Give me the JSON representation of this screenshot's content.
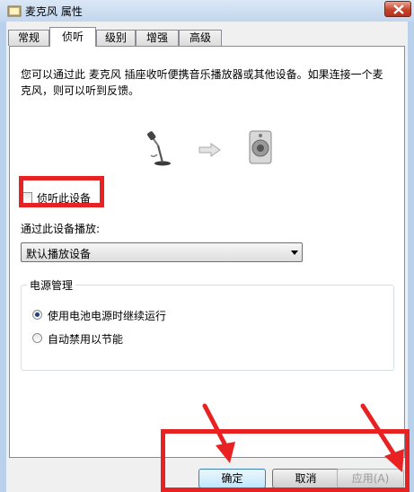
{
  "window": {
    "title": "麦克风 属性",
    "icon": "microphone-icon"
  },
  "tabs": [
    {
      "label": "常规",
      "active": false
    },
    {
      "label": "侦听",
      "active": true
    },
    {
      "label": "级别",
      "active": false
    },
    {
      "label": "增强",
      "active": false
    },
    {
      "label": "高级",
      "active": false
    }
  ],
  "listen": {
    "description": "您可以通过此 麦克风 插座收听便携音乐播放器或其他设备。如果连接一个麦克风，则可以听到反馈。",
    "icons": [
      "microphone-icon",
      "arrow-right-icon",
      "speaker-icon"
    ],
    "checkbox_label": "侦听此设备",
    "checkbox_checked": false,
    "play_through_label": "通过此设备播放:",
    "playback_device": "默认播放设备"
  },
  "power": {
    "group_title": "电源管理",
    "options": [
      {
        "label": "使用电池电源时继续运行",
        "selected": true
      },
      {
        "label": "自动禁用以节能",
        "selected": false
      }
    ]
  },
  "buttons": {
    "ok": "确定",
    "cancel": "取消",
    "apply": "应用(A)"
  },
  "colors": {
    "annotation_red": "#e82222",
    "dialog_bg": "#f0f0f0",
    "close_button": "#c7432b"
  }
}
